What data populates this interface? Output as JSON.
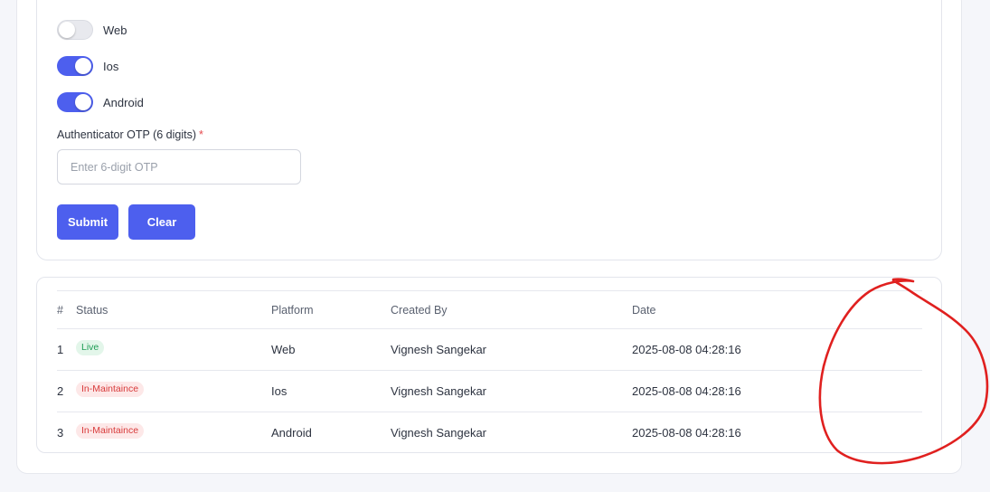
{
  "platform_toggles": [
    {
      "label": "Web",
      "enabled": false
    },
    {
      "label": "Ios",
      "enabled": true
    },
    {
      "label": "Android",
      "enabled": true
    }
  ],
  "otp": {
    "label": "Authenticator OTP (6 digits)",
    "required_marker": "*",
    "placeholder": "Enter 6-digit OTP",
    "value": ""
  },
  "actions": {
    "submit_label": "Submit",
    "clear_label": "Clear"
  },
  "table": {
    "headers": {
      "num": "#",
      "status": "Status",
      "platform": "Platform",
      "created_by": "Created By",
      "date": "Date"
    },
    "rows": [
      {
        "num": "1",
        "status": "Live",
        "platform": "Web",
        "created_by": "Vignesh Sangekar",
        "date": "2025-08-08 04:28:16"
      },
      {
        "num": "2",
        "status": "In-Maintaince",
        "platform": "Ios",
        "created_by": "Vignesh Sangekar",
        "date": "2025-08-08 04:28:16"
      },
      {
        "num": "3",
        "status": "In-Maintaince",
        "platform": "Android",
        "created_by": "Vignesh Sangekar",
        "date": "2025-08-08 04:28:16"
      }
    ]
  },
  "colors": {
    "accent": "#4d5fee",
    "live_badge_bg": "#e3f6ea",
    "live_badge_text": "#1f9d55",
    "maintenance_badge_bg": "#fde8e8",
    "maintenance_badge_text": "#d83a3a",
    "annotation_stroke": "#e0201f"
  }
}
